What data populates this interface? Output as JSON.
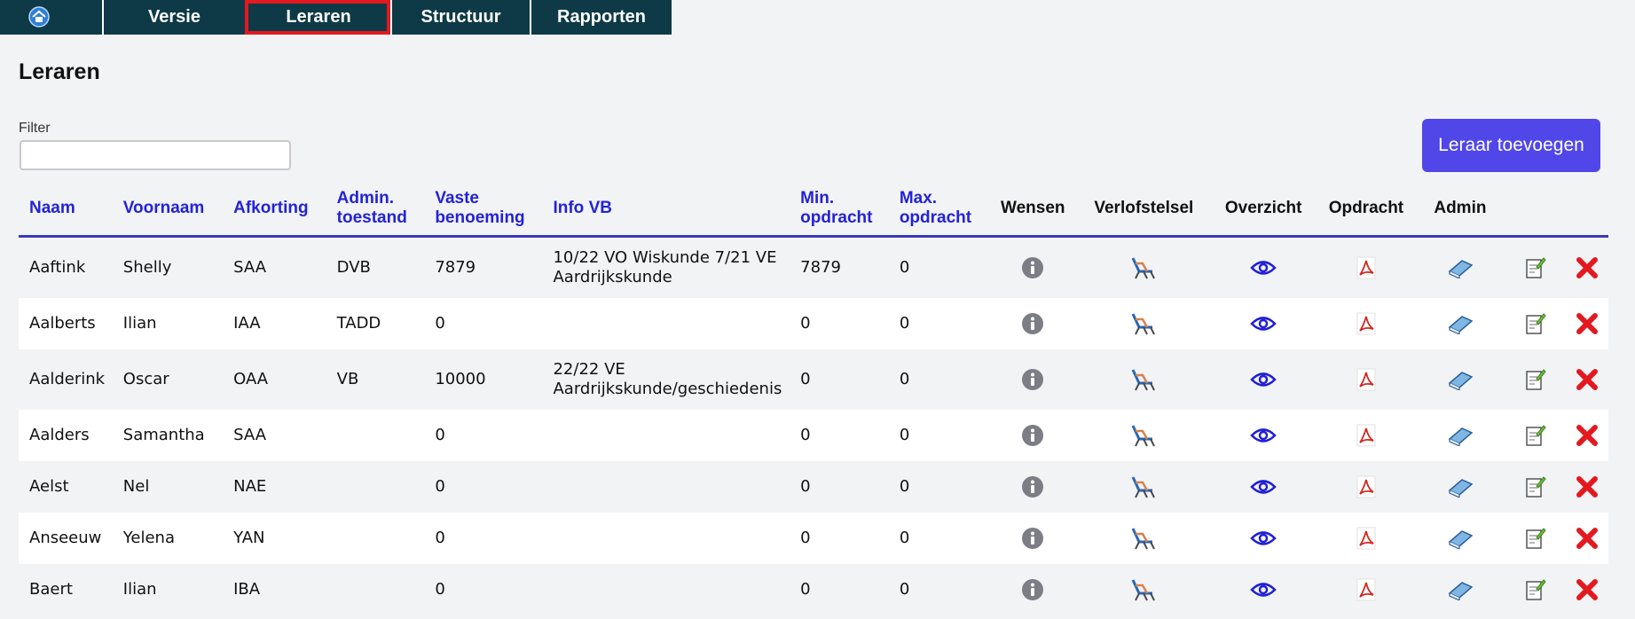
{
  "nav": {
    "items": [
      {
        "label": "Versie"
      },
      {
        "label": "Leraren"
      },
      {
        "label": "Structuur"
      },
      {
        "label": "Rapporten"
      }
    ]
  },
  "page": {
    "title": "Leraren",
    "filter_label": "Filter",
    "filter_value": "",
    "add_button": "Leraar toevoegen"
  },
  "table": {
    "headers": {
      "naam": "Naam",
      "voornaam": "Voornaam",
      "afkorting": "Afkorting",
      "admin_toestand": "Admin. toestand",
      "vaste_benoeming": "Vaste benoeming",
      "info_vb": "Info VB",
      "min_opdracht": "Min. opdracht",
      "max_opdracht": "Max. opdracht",
      "wensen": "Wensen",
      "verlofstelsel": "Verlofstelsel",
      "overzicht": "Overzicht",
      "opdracht": "Opdracht",
      "admin": "Admin"
    },
    "rows": [
      {
        "naam": "Aaftink",
        "voornaam": "Shelly",
        "afkorting": "SAA",
        "admin": "DVB",
        "vaste": "7879",
        "info": "10/22 VO Wiskunde 7/21 VE Aardrijkskunde",
        "min": "7879",
        "max": "0"
      },
      {
        "naam": "Aalberts",
        "voornaam": "Ilian",
        "afkorting": "IAA",
        "admin": "TADD",
        "vaste": "0",
        "info": "",
        "min": "0",
        "max": "0"
      },
      {
        "naam": "Aalderink",
        "voornaam": "Oscar",
        "afkorting": "OAA",
        "admin": "VB",
        "vaste": "10000",
        "info": "22/22 VE Aardrijkskunde/geschiedenis",
        "min": "0",
        "max": "0"
      },
      {
        "naam": "Aalders",
        "voornaam": "Samantha",
        "afkorting": "SAA",
        "admin": "",
        "vaste": "0",
        "info": "",
        "min": "0",
        "max": "0"
      },
      {
        "naam": "Aelst",
        "voornaam": "Nel",
        "afkorting": "NAE",
        "admin": "",
        "vaste": "0",
        "info": "",
        "min": "0",
        "max": "0"
      },
      {
        "naam": "Anseeuw",
        "voornaam": "Yelena",
        "afkorting": "YAN",
        "admin": "",
        "vaste": "0",
        "info": "",
        "min": "0",
        "max": "0"
      },
      {
        "naam": "Baert",
        "voornaam": "Ilian",
        "afkorting": "IBA",
        "admin": "",
        "vaste": "0",
        "info": "",
        "min": "0",
        "max": "0"
      }
    ]
  },
  "icons": {
    "wensen": "info-icon",
    "verlofstelsel": "beach-chair-icon",
    "overzicht": "eye-icon",
    "opdracht": "pdf-icon",
    "admin": "book-icon",
    "edit": "edit-icon",
    "delete": "delete-icon"
  },
  "colors": {
    "nav_bg": "#0e3a47",
    "accent": "#5147e8",
    "header_link": "#2323d6",
    "active_outline": "#e3191f",
    "delete_red": "#e3191f"
  }
}
